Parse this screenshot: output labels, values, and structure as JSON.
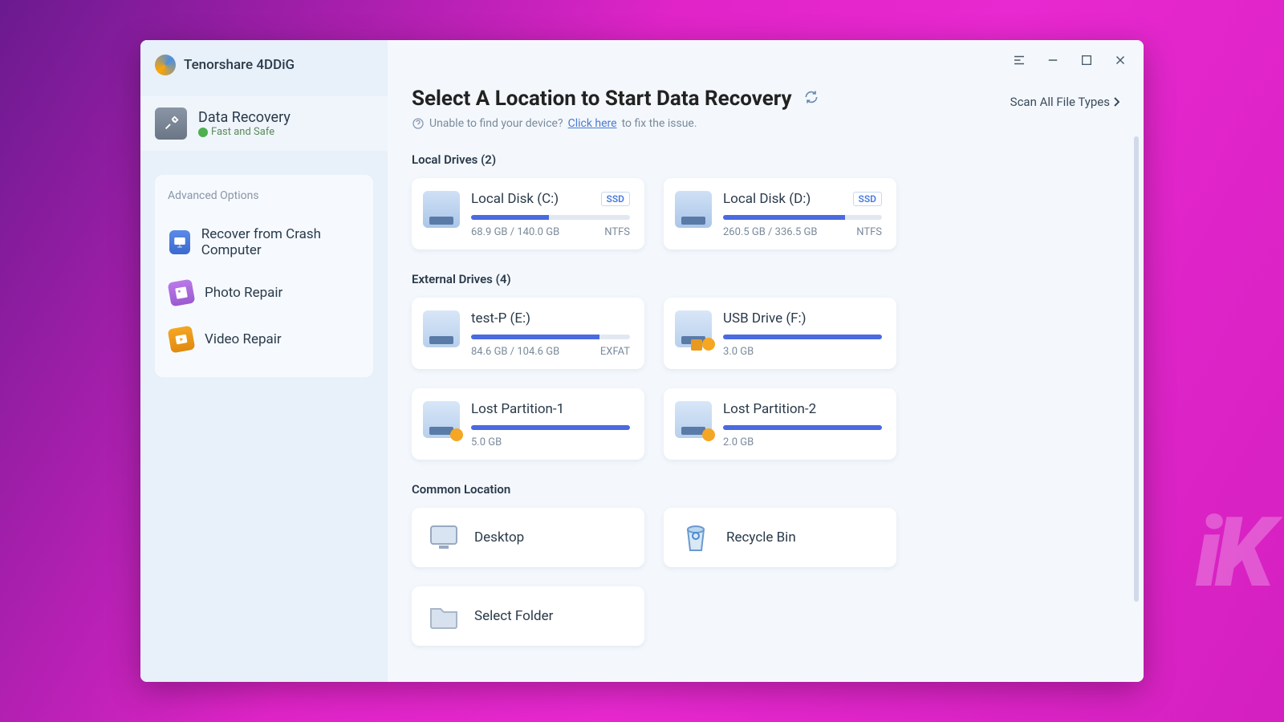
{
  "app": {
    "title": "Tenorshare 4DDiG"
  },
  "sidebar": {
    "primary": {
      "title": "Data Recovery",
      "subtitle": "Fast and Safe"
    },
    "advanced_title": "Advanced Options",
    "items": [
      {
        "label": "Recover from Crash Computer"
      },
      {
        "label": "Photo Repair"
      },
      {
        "label": "Video Repair"
      }
    ]
  },
  "main": {
    "title": "Select A Location to Start Data Recovery",
    "help_prefix": "Unable to find your device?",
    "help_link": "Click here",
    "help_suffix": "to fix the issue.",
    "scan_all": "Scan All File Types"
  },
  "local_drives": {
    "title": "Local Drives (2)",
    "items": [
      {
        "name": "Local Disk (C:)",
        "tag": "SSD",
        "usage_pct": 49,
        "size_text": "68.9 GB / 140.0 GB",
        "fs": "NTFS"
      },
      {
        "name": "Local Disk (D:)",
        "tag": "SSD",
        "usage_pct": 77,
        "size_text": "260.5 GB / 336.5 GB",
        "fs": "NTFS"
      }
    ]
  },
  "external_drives": {
    "title": "External Drives (4)",
    "items": [
      {
        "name": "test-P (E:)",
        "usage_pct": 81,
        "size_text": "84.6 GB / 104.6 GB",
        "fs": "EXFAT",
        "icon": "usb"
      },
      {
        "name": "USB Drive (F:)",
        "usage_pct": 100,
        "size_text": "3.0 GB",
        "fs": "",
        "icon": "usb",
        "warn": true
      },
      {
        "name": "Lost Partition-1",
        "usage_pct": 100,
        "size_text": "5.0 GB",
        "fs": "",
        "icon": "usb",
        "warn": true
      },
      {
        "name": "Lost Partition-2",
        "usage_pct": 100,
        "size_text": "2.0 GB",
        "fs": "",
        "icon": "usb",
        "warn": true
      }
    ]
  },
  "common": {
    "title": "Common Location",
    "items": [
      {
        "label": "Desktop",
        "icon": "desktop"
      },
      {
        "label": "Recycle Bin",
        "icon": "recycle"
      },
      {
        "label": "Select Folder",
        "icon": "folder"
      }
    ]
  },
  "watermark": "iK"
}
